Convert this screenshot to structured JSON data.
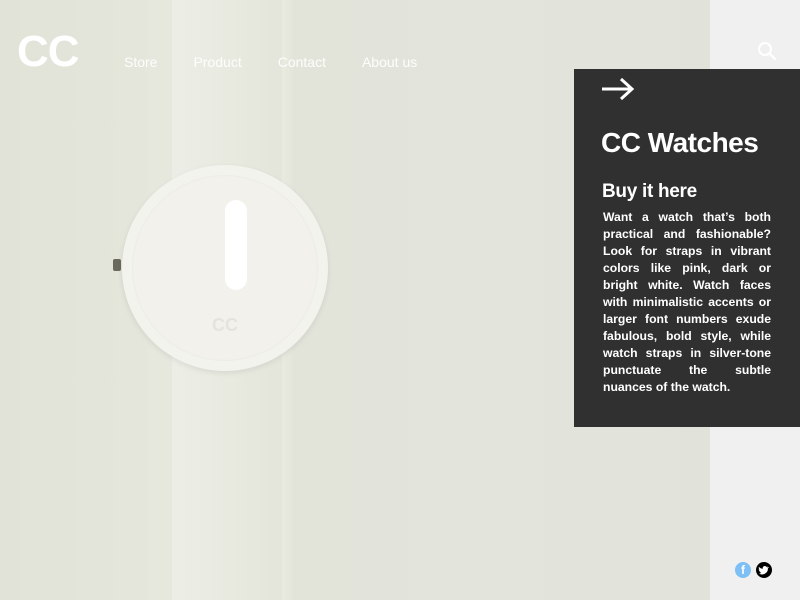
{
  "brand": {
    "logo": "CC"
  },
  "nav": {
    "items": [
      {
        "label": "Store"
      },
      {
        "label": "Product"
      },
      {
        "label": "Contact"
      },
      {
        "label": "About us"
      }
    ]
  },
  "header": {
    "search_icon": "search-icon"
  },
  "hero": {
    "watch_face_logo": "CC"
  },
  "panel": {
    "arrow_icon": "arrow-right-icon",
    "title": "CC Watches",
    "subtitle": "Buy it here",
    "body": "Want a watch that’s both practical and fashionable? Look for straps in vibrant colors like pink, dark or bright white. Watch faces with minimalistic accents or larger font numbers exude fabulous, bold style, while watch straps in silver-tone punctuate the subtle nuances of the watch."
  },
  "social": {
    "facebook_glyph": "f",
    "items": [
      "facebook-icon",
      "twitter-icon"
    ]
  },
  "colors": {
    "panel_bg": "#303030",
    "facebook": "#7ec0f5",
    "twitter": "#000000"
  }
}
